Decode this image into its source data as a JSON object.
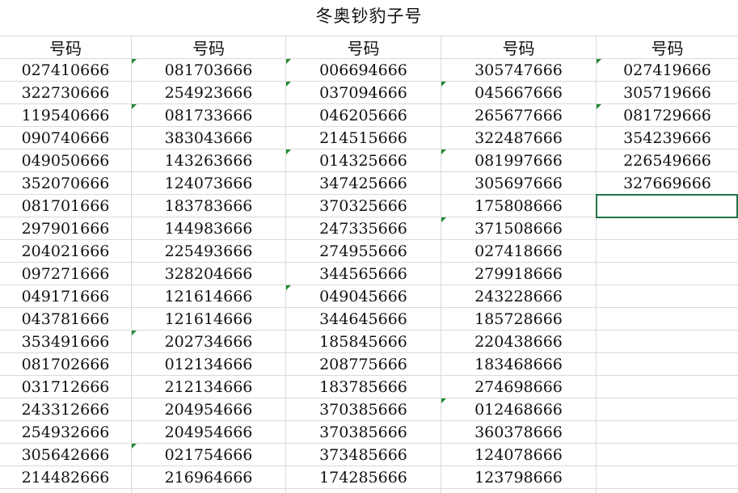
{
  "sheet": {
    "title": "冬奥钞豹子号",
    "columns": [
      {
        "header": "号码",
        "values": [
          "027410666",
          "322730666",
          "119540666",
          "090740666",
          "049050666",
          "352070666",
          "081701666",
          "297901666",
          "204021666",
          "097271666",
          "049171666",
          "043781666",
          "353491666",
          "081702666",
          "031712666",
          "243312666",
          "254932666",
          "305642666",
          "214482666"
        ]
      },
      {
        "header": "号码",
        "values": [
          "081703666",
          "254923666",
          "081733666",
          "383043666",
          "143263666",
          "124073666",
          "183783666",
          "144983666",
          "225493666",
          "328204666",
          "121614666",
          "121614666",
          "202734666",
          "012134666",
          "212134666",
          "204954666",
          "204954666",
          "021754666",
          "216964666"
        ]
      },
      {
        "header": "号码",
        "values": [
          "006694666",
          "037094666",
          "046205666",
          "214515666",
          "014325666",
          "347425666",
          "370325666",
          "247335666",
          "274955666",
          "344565666",
          "049045666",
          "344645666",
          "185845666",
          "208775666",
          "183785666",
          "370385666",
          "370385666",
          "373485666",
          "174285666"
        ]
      },
      {
        "header": "号码",
        "values": [
          "305747666",
          "045667666",
          "265677666",
          "322487666",
          "081997666",
          "305697666",
          "175808666",
          "371508666",
          "027418666",
          "279918666",
          "243228666",
          "185728666",
          "220438666",
          "183468666",
          "274698666",
          "012468666",
          "360378666",
          "124078666",
          "123798666"
        ]
      },
      {
        "header": "号码",
        "values": [
          "027419666",
          "305719666",
          "081729666",
          "354239666",
          "226549666",
          "327669666",
          "",
          "",
          "",
          "",
          "",
          "",
          "",
          "",
          "",
          "",
          "",
          "",
          ""
        ]
      }
    ]
  }
}
